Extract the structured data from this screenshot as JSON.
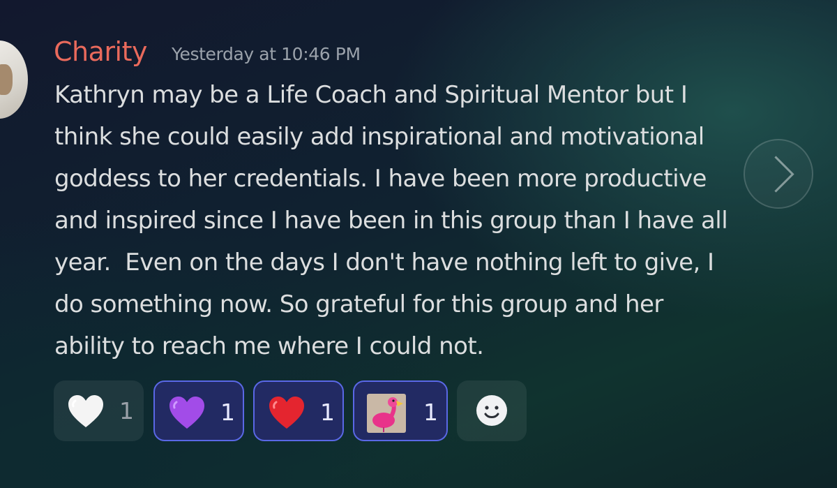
{
  "message": {
    "author": "Charity",
    "timestamp": "Yesterday at 10:46 PM",
    "author_color": "#ea6a5c",
    "lines": [
      "Kathryn may be a Life Coach and Spiritual Mentor but I",
      "think she could easily add inspirational and motivational",
      "goddess to her credentials. I have been more productive",
      "and inspired since I have been in this group than I have all",
      "year.  Even on the days I don't have nothing left to give, I",
      "do something now. So grateful for this group and her",
      "ability to reach me where I could not."
    ]
  },
  "reactions": [
    {
      "emoji": "white-heart-icon",
      "count": "1",
      "selected": false
    },
    {
      "emoji": "purple-heart-icon",
      "count": "1",
      "selected": true
    },
    {
      "emoji": "red-heart-icon",
      "count": "1",
      "selected": true
    },
    {
      "emoji": "flamingo-icon",
      "count": "1",
      "selected": true
    }
  ],
  "icons": {
    "next": "chevron-right-icon",
    "add_reaction": "add-reaction-smiley-icon"
  },
  "colors": {
    "selected_reaction_bg": "#222a63",
    "selected_reaction_border": "#5a68e6"
  }
}
